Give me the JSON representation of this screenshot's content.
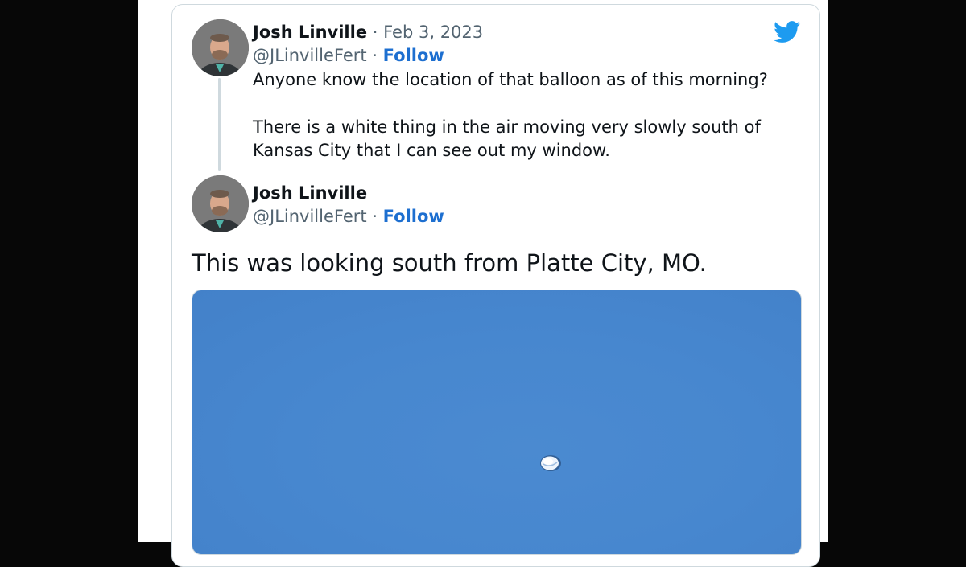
{
  "tweet1": {
    "name": "Josh Linville",
    "separator": "·",
    "date": "Feb 3, 2023",
    "handle": "@JLinvilleFert",
    "follow": "Follow",
    "text_line1": "Anyone know the location of that balloon as of this morning?",
    "text_line2": "There is a white thing in the air moving very slowly south of Kansas City that I can see out my window."
  },
  "tweet2": {
    "name": "Josh Linville",
    "handle": "@JLinvilleFert",
    "separator": "·",
    "follow": "Follow",
    "text": "This was looking south from Platte City, MO."
  },
  "icons": {
    "logo": "twitter-bird-icon",
    "avatar": "profile-photo"
  },
  "colors": {
    "follow": "#1d6fd0",
    "twitter_blue": "#1d9bf0",
    "sky": "#4787cf"
  }
}
